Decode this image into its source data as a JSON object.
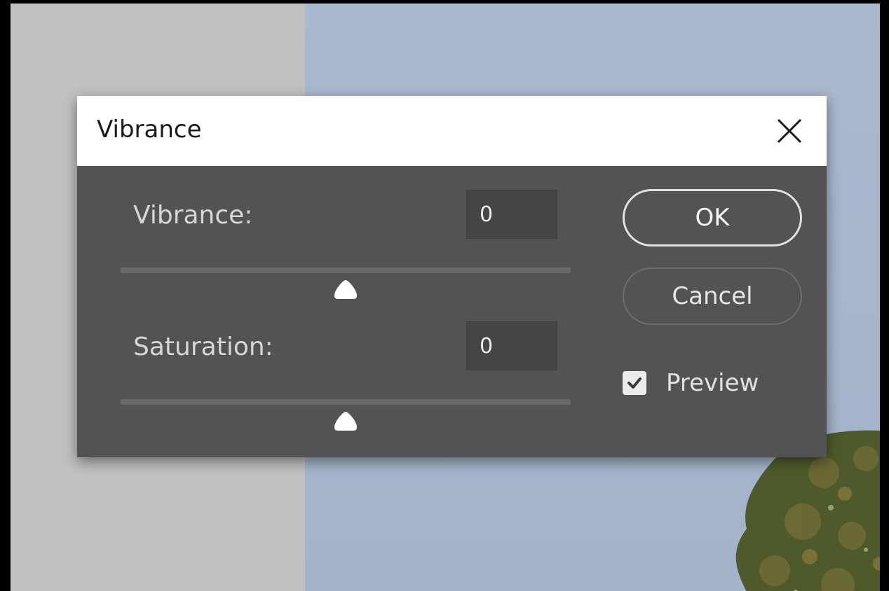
{
  "dialog": {
    "title": "Vibrance",
    "fields": [
      {
        "label": "Vibrance:",
        "value": "0",
        "slider_fraction": 0.5
      },
      {
        "label": "Saturation:",
        "value": "0",
        "slider_fraction": 0.5
      }
    ],
    "ok_label": "OK",
    "cancel_label": "Cancel",
    "preview_label": "Preview",
    "preview_checked": true
  },
  "icons": {
    "close": "close-icon",
    "check": "checkmark-icon",
    "slider_thumb": "slider-thumb-icon"
  },
  "colors": {
    "dialog_bg": "#535353",
    "titlebar_bg": "#ffffff",
    "canvas_gray": "#c1c1c1",
    "sky": "#a9b9cf"
  }
}
